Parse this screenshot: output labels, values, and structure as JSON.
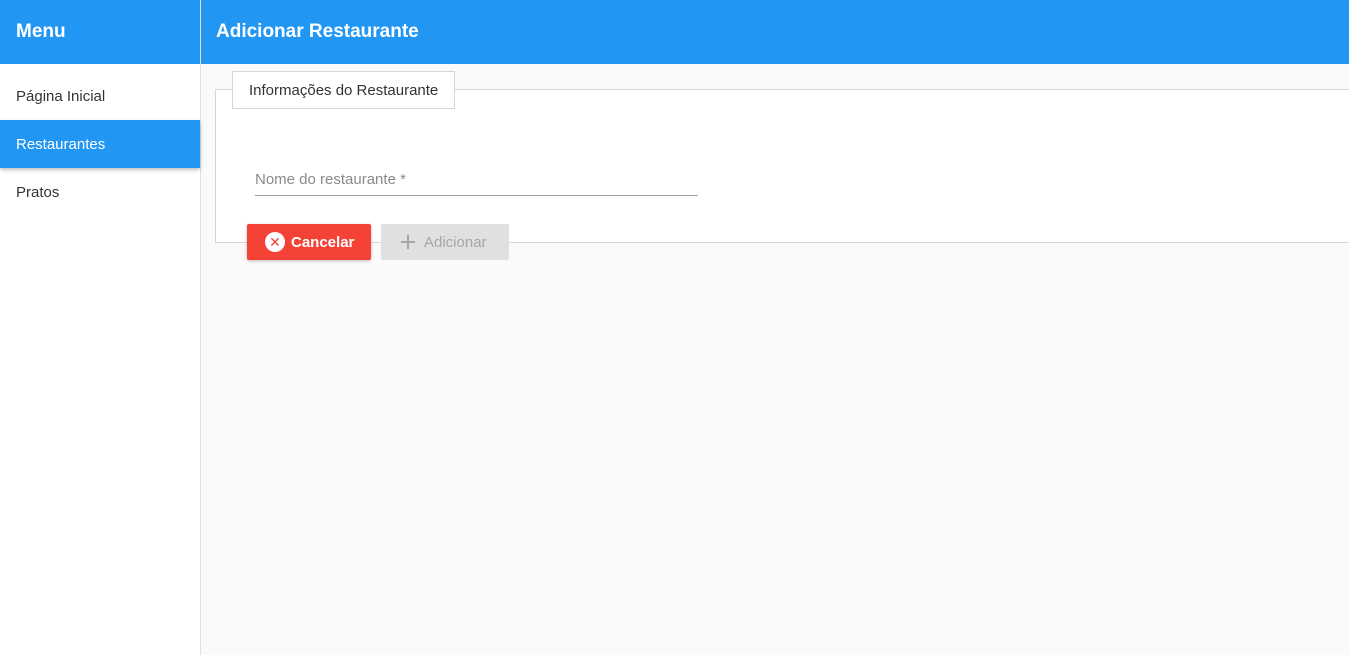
{
  "sidebar": {
    "title": "Menu",
    "items": [
      {
        "label": "Página Inicial",
        "active": false
      },
      {
        "label": "Restaurantes",
        "active": true
      },
      {
        "label": "Pratos",
        "active": false
      }
    ]
  },
  "header": {
    "title": "Adicionar Restaurante"
  },
  "form": {
    "legend": "Informações do Restaurante",
    "name_field": {
      "placeholder": "Nome do restaurante *",
      "value": ""
    },
    "cancel_label": "Cancelar",
    "cancel_icon": "close-circle-icon",
    "add_label": "Adicionar",
    "add_icon": "plus-icon",
    "add_disabled": true
  },
  "colors": {
    "primary": "#2196f3",
    "danger": "#f44336",
    "disabled_bg": "#e0e0e0",
    "disabled_text": "#a6a6a6"
  }
}
